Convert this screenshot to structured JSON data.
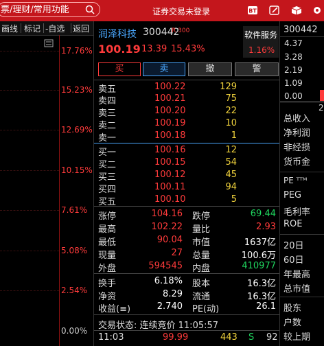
{
  "topbar": {
    "search_text": "票/理财/常用功能",
    "login_status": "证券交易未登录",
    "icons": [
      "bt-icon",
      "edit-icon",
      "box-icon",
      "gear-icon"
    ]
  },
  "chart_toolbar": {
    "items": [
      "画线",
      "标记",
      "-自选",
      "返回"
    ]
  },
  "chart": {
    "pct_labels": [
      "17.76%",
      "15.23%",
      "12.69%",
      "10.15%",
      "7.61%",
      "5.08%",
      "2.54%",
      "0.00%"
    ]
  },
  "stock": {
    "name": "润泽科技",
    "code": "300442",
    "badge": "R 300",
    "price": "100.19",
    "change": "13.39",
    "change_pct": "15.43%",
    "sector_name": "软件服务",
    "sector_pct": "1.16%"
  },
  "actions": {
    "buy": "买",
    "sell": "卖",
    "cancel": "撤",
    "alert": "警"
  },
  "orderbook": {
    "asks": [
      {
        "label": "卖五",
        "price": "100.22",
        "vol": "129"
      },
      {
        "label": "卖四",
        "price": "100.21",
        "vol": "75"
      },
      {
        "label": "卖三",
        "price": "100.20",
        "vol": "22"
      },
      {
        "label": "卖二",
        "price": "100.19",
        "vol": "10"
      },
      {
        "label": "卖一",
        "price": "100.18",
        "vol": "1"
      }
    ],
    "bids": [
      {
        "label": "买一",
        "price": "100.16",
        "vol": "12"
      },
      {
        "label": "买二",
        "price": "100.15",
        "vol": "54"
      },
      {
        "label": "买三",
        "price": "100.12",
        "vol": "45"
      },
      {
        "label": "买四",
        "price": "100.11",
        "vol": "94"
      },
      {
        "label": "买五",
        "price": "100.10",
        "vol": "5"
      }
    ]
  },
  "stats": [
    {
      "l1": "涨停",
      "v1": "104.16",
      "c1": "red",
      "l2": "跌停",
      "v2": "69.44",
      "c2": "green"
    },
    {
      "l1": "最高",
      "v1": "102.22",
      "c1": "red",
      "l2": "量比",
      "v2": "2.93",
      "c2": "red"
    },
    {
      "l1": "最低",
      "v1": "90.04",
      "c1": "red",
      "l2": "市值",
      "v2": "1637亿",
      "c2": "white"
    },
    {
      "l1": "现量",
      "v1": "27",
      "c1": "red",
      "l2": "总量",
      "v2": "100.6万",
      "c2": "white"
    },
    {
      "l1": "外盘",
      "v1": "594545",
      "c1": "red",
      "l2": "内盘",
      "v2": "410977",
      "c2": "green"
    }
  ],
  "stats2": [
    {
      "l1": "换手",
      "v1": "6.18%",
      "l2": "股本",
      "v2": "16.3亿"
    },
    {
      "l1": "净资",
      "v1": "8.29",
      "l2": "流通",
      "v2": "16.3亿"
    },
    {
      "l1": "收益(≡)",
      "v1": "2.740",
      "l2": "PE(动)",
      "v2": "26.1"
    }
  ],
  "trade_status": "交易状态: 连续竞价 11:05:57",
  "tick": {
    "time": "11:03",
    "price": "99.99",
    "vol": "443",
    "dir": "S",
    "count": "92"
  },
  "right_panel": {
    "code": "300442",
    "scale": [
      "4.37",
      "3.28",
      "2.19",
      "1.09",
      "0.00"
    ],
    "date_fragment": "2",
    "items1": [
      "总收入",
      "净利润",
      "非经损",
      "货币金"
    ],
    "items2": [
      "PE ᵀᵀᴹ",
      "PEG",
      "毛利率",
      "ROE"
    ],
    "items3": [
      "20日",
      "60日",
      "年最高",
      "总市值"
    ],
    "items4": [
      "股东",
      "户数",
      "较上期"
    ]
  }
}
